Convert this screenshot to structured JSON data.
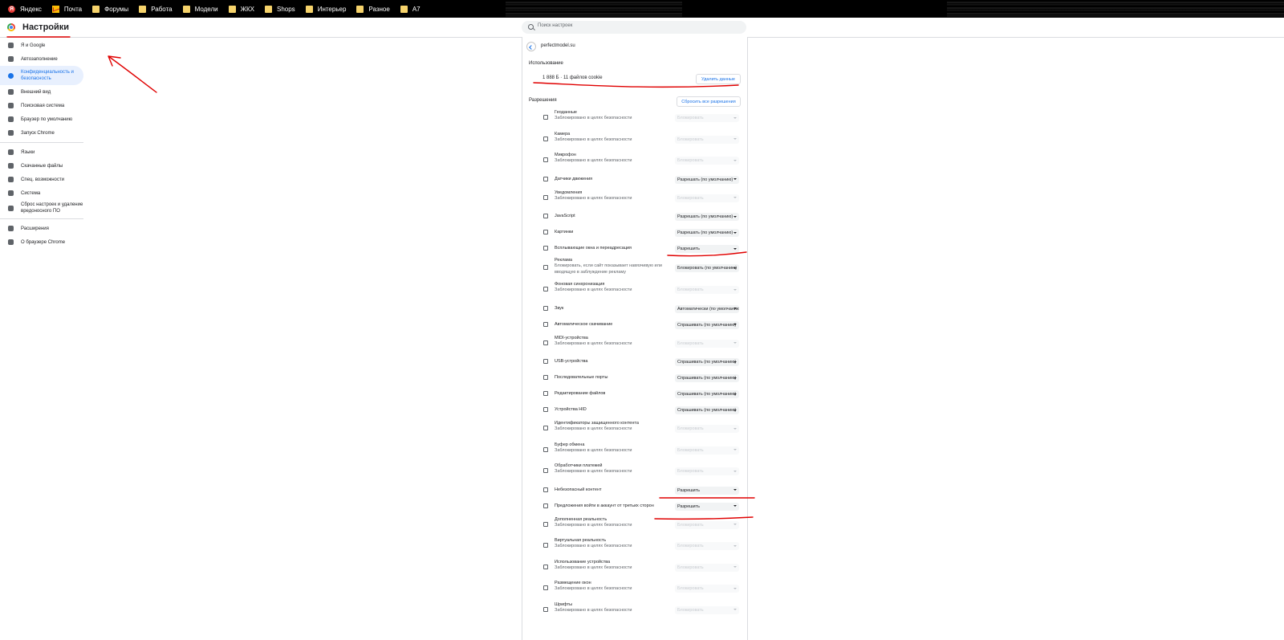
{
  "bookmarks": [
    {
      "label": "Яндекс",
      "icon": "yandex-icon"
    },
    {
      "label": "Почта",
      "icon": "mail-icon"
    },
    {
      "label": "Форумы",
      "icon": "folder-icon"
    },
    {
      "label": "Работа",
      "icon": "folder-icon"
    },
    {
      "label": "Модели",
      "icon": "folder-icon"
    },
    {
      "label": "ЖКХ",
      "icon": "folder-icon"
    },
    {
      "label": "Shops",
      "icon": "folder-icon"
    },
    {
      "label": "Интерьер",
      "icon": "folder-icon"
    },
    {
      "label": "Разное",
      "icon": "folder-icon"
    },
    {
      "label": "А7",
      "icon": "folder-icon"
    }
  ],
  "header": {
    "title": "Настройки",
    "search_placeholder": "Поиск настроек"
  },
  "sidebar": {
    "group1": [
      "Я и Google",
      "Автозаполнение",
      "Конфиденциальность и безопасность",
      "Внешний вид",
      "Поисковая система",
      "Браузер по умолчанию",
      "Запуск Chrome"
    ],
    "group2": [
      "Языки",
      "Скачанные файлы",
      "Спец. возможности",
      "Система",
      "Сброс настроек и удаление вредоносного ПО"
    ],
    "group3": [
      "Расширения",
      "О браузере Chrome"
    ],
    "active": "Конфиденциальность и безопасность"
  },
  "site": {
    "name": "perfectmodel.su",
    "usage_heading": "Использование",
    "usage_text": "1 888 Б · 11 файлов cookie",
    "delete_button": "Удалить данные",
    "permissions_heading": "Разрешения",
    "reset_button": "Сбросить все разрешения"
  },
  "permissions": [
    {
      "title": "Геоданные",
      "sub": "Заблокировано в целях безопасности",
      "value": "Блокировать",
      "disabled": true,
      "icon": "location-icon"
    },
    {
      "title": "Камера",
      "sub": "Заблокировано в целях безопасности",
      "value": "Блокировать",
      "disabled": true,
      "icon": "camera-icon"
    },
    {
      "title": "Микрофон",
      "sub": "Заблокировано в целях безопасности",
      "value": "Блокировать",
      "disabled": true,
      "icon": "microphone-icon"
    },
    {
      "title": "Датчики движения",
      "sub": "",
      "value": "Разрешать (по умолчанию)",
      "disabled": false,
      "icon": "sensors-icon"
    },
    {
      "title": "Уведомления",
      "sub": "Заблокировано в целях безопасности",
      "value": "Блокировать",
      "disabled": true,
      "icon": "bell-icon"
    },
    {
      "title": "JavaScript",
      "sub": "",
      "value": "Разрешать (по умолчанию)",
      "disabled": false,
      "icon": "code-icon"
    },
    {
      "title": "Картинки",
      "sub": "",
      "value": "Разрешать (по умолчанию)",
      "disabled": false,
      "icon": "image-icon"
    },
    {
      "title": "Всплывающие окна и переадресация",
      "sub": "",
      "value": "Разрешить",
      "disabled": false,
      "icon": "popup-icon"
    },
    {
      "title": "Реклама",
      "sub": "Блокировать, если сайт показывает навязчивую или",
      "sub2": "вводящую в заблуждение рекламу",
      "value": "Блокировать (по умолчанию)",
      "disabled": false,
      "icon": "ads-icon"
    },
    {
      "title": "Фоновая синхронизация",
      "sub": "Заблокировано в целях безопасности",
      "value": "Блокировать",
      "disabled": true,
      "icon": "sync-icon"
    },
    {
      "title": "Звук",
      "sub": "",
      "value": "Автоматически (по умолчанию)",
      "disabled": false,
      "icon": "sound-icon"
    },
    {
      "title": "Автоматическое скачивание",
      "sub": "",
      "value": "Спрашивать (по умолчанию)",
      "disabled": false,
      "icon": "download-icon"
    },
    {
      "title": "MIDI-устройства",
      "sub": "Заблокировано в целях безопасности",
      "value": "Блокировать",
      "disabled": true,
      "icon": "midi-icon"
    },
    {
      "title": "USB-устройства",
      "sub": "",
      "value": "Спрашивать (по умолчанию)",
      "disabled": false,
      "icon": "usb-icon"
    },
    {
      "title": "Последовательные порты",
      "sub": "",
      "value": "Спрашивать (по умолчанию)",
      "disabled": false,
      "icon": "serial-port-icon"
    },
    {
      "title": "Редактирование файлов",
      "sub": "",
      "value": "Спрашивать (по умолчанию)",
      "disabled": false,
      "icon": "file-edit-icon"
    },
    {
      "title": "Устройства HID",
      "sub": "",
      "value": "Спрашивать (по умолчанию)",
      "disabled": false,
      "icon": "hid-icon"
    },
    {
      "title": "Идентификаторы защищенного контента",
      "sub": "Заблокировано в целях безопасности",
      "value": "Блокировать",
      "disabled": true,
      "icon": "protected-content-icon"
    },
    {
      "title": "Буфер обмена",
      "sub": "Заблокировано в целях безопасности",
      "value": "Блокировать",
      "disabled": true,
      "icon": "clipboard-icon"
    },
    {
      "title": "Обработчики платежей",
      "sub": "Заблокировано в целях безопасности",
      "value": "Блокировать",
      "disabled": true,
      "icon": "payment-icon"
    },
    {
      "title": "Небезопасный контент",
      "sub": "",
      "value": "Разрешить",
      "disabled": false,
      "icon": "warning-icon"
    },
    {
      "title": "Предложения войти в аккаунт от третьих сторон",
      "sub": "",
      "value": "Разрешить",
      "disabled": false,
      "icon": "account-icon"
    },
    {
      "title": "Дополненная реальность",
      "sub": "Заблокировано в целях безопасности",
      "value": "Блокировать",
      "disabled": true,
      "icon": "ar-icon"
    },
    {
      "title": "Виртуальная реальность",
      "sub": "Заблокировано в целях безопасности",
      "value": "Блокировать",
      "disabled": true,
      "icon": "vr-icon"
    },
    {
      "title": "Использование устройства",
      "sub": "Заблокировано в целях безопасности",
      "value": "Блокировать",
      "disabled": true,
      "icon": "device-use-icon"
    },
    {
      "title": "Размещение окон",
      "sub": "Заблокировано в целях безопасности",
      "value": "Блокировать",
      "disabled": true,
      "icon": "window-placement-icon"
    },
    {
      "title": "Шрифты",
      "sub": "Заблокировано в целях безопасности",
      "value": "Блокировать",
      "disabled": true,
      "icon": "fonts-icon"
    }
  ],
  "colors": {
    "accent": "#1a73e8",
    "annotation": "#e00000"
  }
}
